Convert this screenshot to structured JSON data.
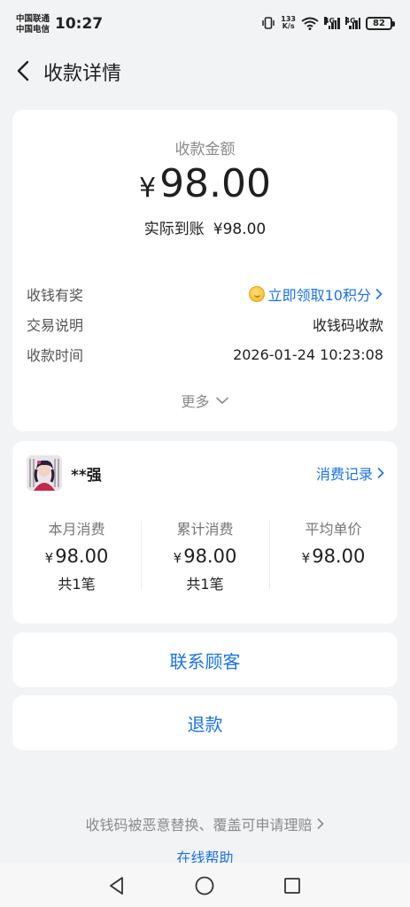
{
  "status_bar": {
    "carrier1": "中国联通",
    "carrier2": "中国电信",
    "time": "10:27",
    "net_speed_value": "133",
    "net_speed_unit": "K/s",
    "sig1_label": "4G",
    "sig2_label": "4G",
    "battery": "82"
  },
  "header": {
    "title": "收款详情"
  },
  "amount": {
    "label": "收款金额",
    "currency": "¥",
    "value": "98.00",
    "received_label": "实际到账",
    "received_value": "¥98.00"
  },
  "details": [
    {
      "label": "收钱有奖",
      "value": "立即领取10积分"
    },
    {
      "label": "交易说明",
      "value": "收钱码收款"
    },
    {
      "label": "收款时间",
      "value": "2026-01-24 10:23:08"
    }
  ],
  "more_label": "更多",
  "customer": {
    "name": "**强",
    "records_link": "消费记录",
    "stats": [
      {
        "label": "本月消费",
        "currency": "¥",
        "value": "98.00",
        "count": "共1笔"
      },
      {
        "label": "累计消费",
        "currency": "¥",
        "value": "98.00",
        "count": "共1笔"
      },
      {
        "label": "平均单价",
        "currency": "¥",
        "value": "98.00",
        "count": ""
      }
    ]
  },
  "actions": {
    "contact": "联系顾客",
    "refund": "退款"
  },
  "footer": {
    "note": "收钱码被恶意替换、覆盖可申请理赔",
    "help": "在线帮助"
  },
  "colors": {
    "accent": "#1a73e8",
    "background": "#f2f3f5",
    "card": "#ffffff",
    "muted_text": "#8a8a8a"
  },
  "icons": [
    "back-arrow-icon",
    "coin-icon",
    "chevron-right-icon",
    "chevron-down-icon",
    "vibrate-icon",
    "wifi-icon",
    "signal-icon",
    "battery-icon",
    "nav-back-icon",
    "nav-home-icon",
    "nav-recents-icon"
  ]
}
